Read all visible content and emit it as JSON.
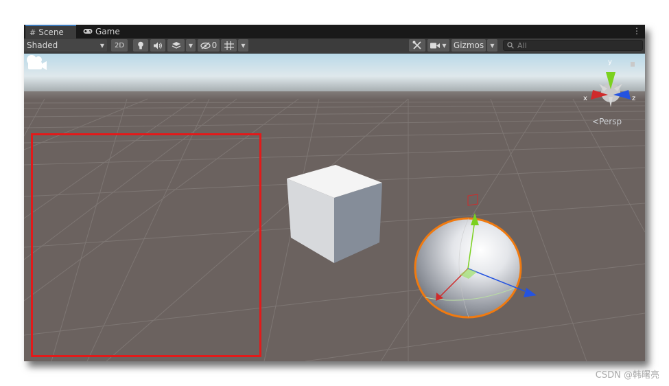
{
  "tabs": [
    {
      "label": "Scene",
      "icon": "grid-icon",
      "active": true
    },
    {
      "label": "Game",
      "icon": "gamepad-icon",
      "active": false
    }
  ],
  "toolbar": {
    "draw_mode": "Shaded",
    "mode_2d": "2D",
    "hidden_count": "0",
    "gizmos_label": "Gizmos",
    "search_placeholder": "All"
  },
  "scene_gizmo": {
    "axis_x": "x",
    "axis_y": "y",
    "axis_z": "z",
    "projection_label": "Persp"
  },
  "watermark": "CSDN @韩曙亮",
  "colors": {
    "selection_outline": "#e21a1a",
    "tab_accent": "#3a79bb",
    "axis_x": "#d02b2b",
    "axis_y": "#7bd11f",
    "axis_z": "#2453e0",
    "sphere_outline": "#f07a10"
  }
}
